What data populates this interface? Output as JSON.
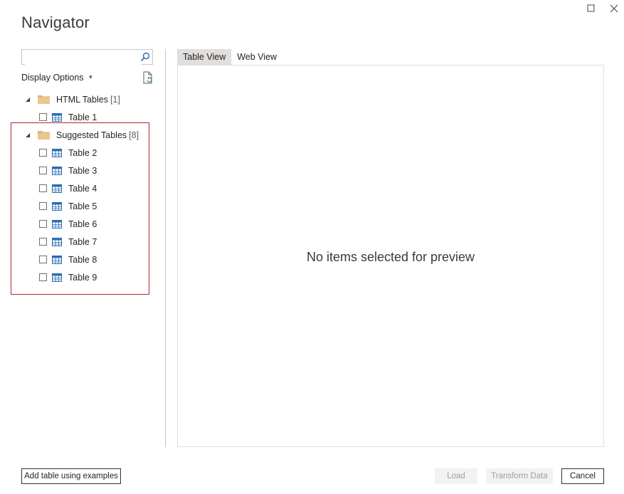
{
  "window": {
    "title": "Navigator",
    "controls": [
      "maximize-icon",
      "close-icon"
    ]
  },
  "search": {
    "value": "",
    "placeholder": "",
    "icon": "search-icon"
  },
  "display_options": {
    "label": "Display Options",
    "icon": "refresh-icon"
  },
  "tree": {
    "groups": [
      {
        "label": "HTML Tables",
        "count": "[1]",
        "expanded": true,
        "items": [
          {
            "label": "Table 1",
            "checked": false
          }
        ]
      },
      {
        "label": "Suggested Tables",
        "count": "[8]",
        "expanded": true,
        "highlighted": true,
        "items": [
          {
            "label": "Table 2",
            "checked": false
          },
          {
            "label": "Table 3",
            "checked": false
          },
          {
            "label": "Table 4",
            "checked": false
          },
          {
            "label": "Table 5",
            "checked": false
          },
          {
            "label": "Table 6",
            "checked": false
          },
          {
            "label": "Table 7",
            "checked": false
          },
          {
            "label": "Table 8",
            "checked": false
          },
          {
            "label": "Table 9",
            "checked": false
          }
        ]
      }
    ]
  },
  "tabs": [
    {
      "label": "Table View",
      "active": true
    },
    {
      "label": "Web View",
      "active": false
    }
  ],
  "preview": {
    "message": "No items selected for preview"
  },
  "footer": {
    "add_examples_label": "Add table using examples",
    "load_label": "Load",
    "transform_label": "Transform Data",
    "cancel_label": "Cancel"
  },
  "colors": {
    "highlight_border": "#b3262b",
    "folder": "#dcb67a",
    "table_icon": "#2b6cb0",
    "active_tab": "#e1dfdd"
  }
}
